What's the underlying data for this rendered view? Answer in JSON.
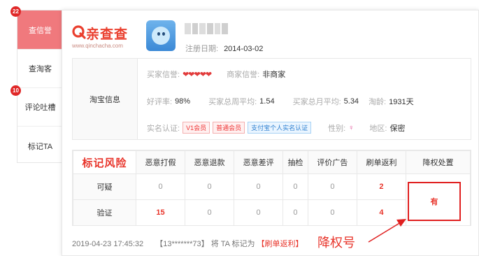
{
  "tabs": [
    {
      "label": "查信誉",
      "active": true,
      "badge": "22"
    },
    {
      "label": "查淘客",
      "active": false,
      "badge": ""
    },
    {
      "label": "评论吐槽",
      "active": false,
      "badge": "10"
    },
    {
      "label": "标记TA",
      "active": false,
      "badge": ""
    }
  ],
  "logo": {
    "text": "亲查查",
    "url": "www.qinchacha.com"
  },
  "profile": {
    "reg_label": "注册日期:",
    "reg_date": "2014-03-02"
  },
  "taobao": {
    "section_label": "淘宝信息",
    "buyer_credit_label": "买家信誉:",
    "buyer_credit_hearts": "❤❤❤❤❤",
    "seller_credit_label": "商家信誉:",
    "seller_credit_value": "非商家",
    "good_rate_label": "好评率:",
    "good_rate_value": "98%",
    "weekly_avg_label": "买家总周平均:",
    "weekly_avg_value": "1.54",
    "monthly_avg_label": "买家总月平均:",
    "monthly_avg_value": "5.34",
    "age_label": "淘龄:",
    "age_value": "1931天",
    "verify_label": "实名认证:",
    "tag_v1": "V1会员",
    "tag_normal": "普通会员",
    "tag_alipay": "支付宝个人实名认证",
    "gender_label": "性别:",
    "gender_value": "♀",
    "region_label": "地区:",
    "region_value": "保密"
  },
  "risk": {
    "title": "标记风险",
    "columns": [
      "恶意打假",
      "恶意退款",
      "恶意差评",
      "抽检",
      "评价广告",
      "刷单返利",
      "降权处置"
    ],
    "rows": [
      {
        "label": "可疑",
        "values": [
          "0",
          "0",
          "0",
          "0",
          "0",
          "2"
        ]
      },
      {
        "label": "验证",
        "values": [
          "15",
          "0",
          "0",
          "0",
          "0",
          "4"
        ]
      }
    ],
    "penalty_value": "有"
  },
  "footer": {
    "time": "2019-04-23 17:45:32",
    "user": "【13*******73】",
    "middle": "将 TA 标记为",
    "mark": "【刷单返利】"
  },
  "annotation": "降权号",
  "colors": {
    "accent": "#e8342a",
    "active_tab": "#f0797d",
    "badge": "#e02727"
  }
}
